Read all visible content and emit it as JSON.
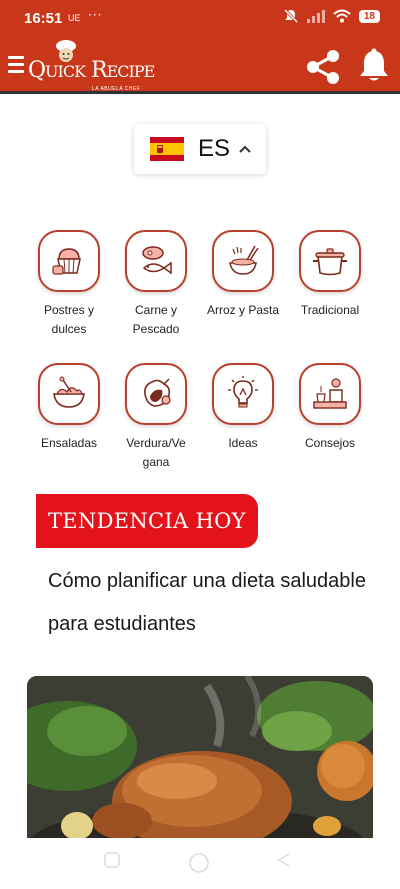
{
  "status_bar": {
    "time": "16:51",
    "carrier": "UE",
    "dots": "···",
    "battery": "18"
  },
  "app_bar": {
    "logo_text_q": "Q",
    "logo_text_uick": "UICK",
    "logo_text_r": "R",
    "logo_text_ecipe": "ECIPE",
    "logo_tagline": "LA ABUELA CHEF",
    "brand_color": "#c8371a"
  },
  "language": {
    "code": "ES",
    "flag": "spain-flag"
  },
  "categories": [
    {
      "label": "Postres y dulces",
      "icon": "cupcake-icon"
    },
    {
      "label": "Carne y Pescado",
      "icon": "meat-fish-icon"
    },
    {
      "label": "Arroz y Pasta",
      "icon": "rice-pasta-icon"
    },
    {
      "label": "Tradicional",
      "icon": "pot-icon"
    },
    {
      "label": "Ensaladas",
      "icon": "salad-bowl-icon"
    },
    {
      "label": "Verdura/Vegana",
      "icon": "vegetables-icon"
    },
    {
      "label": "Ideas",
      "icon": "lightbulb-icon"
    },
    {
      "label": "Consejos",
      "icon": "chef-tips-icon"
    }
  ],
  "trend": {
    "tag": "TENDENCIA HOY",
    "tag_color": "#e3121b",
    "article_title": "Cómo planificar una dieta saludable para estudiantes"
  }
}
